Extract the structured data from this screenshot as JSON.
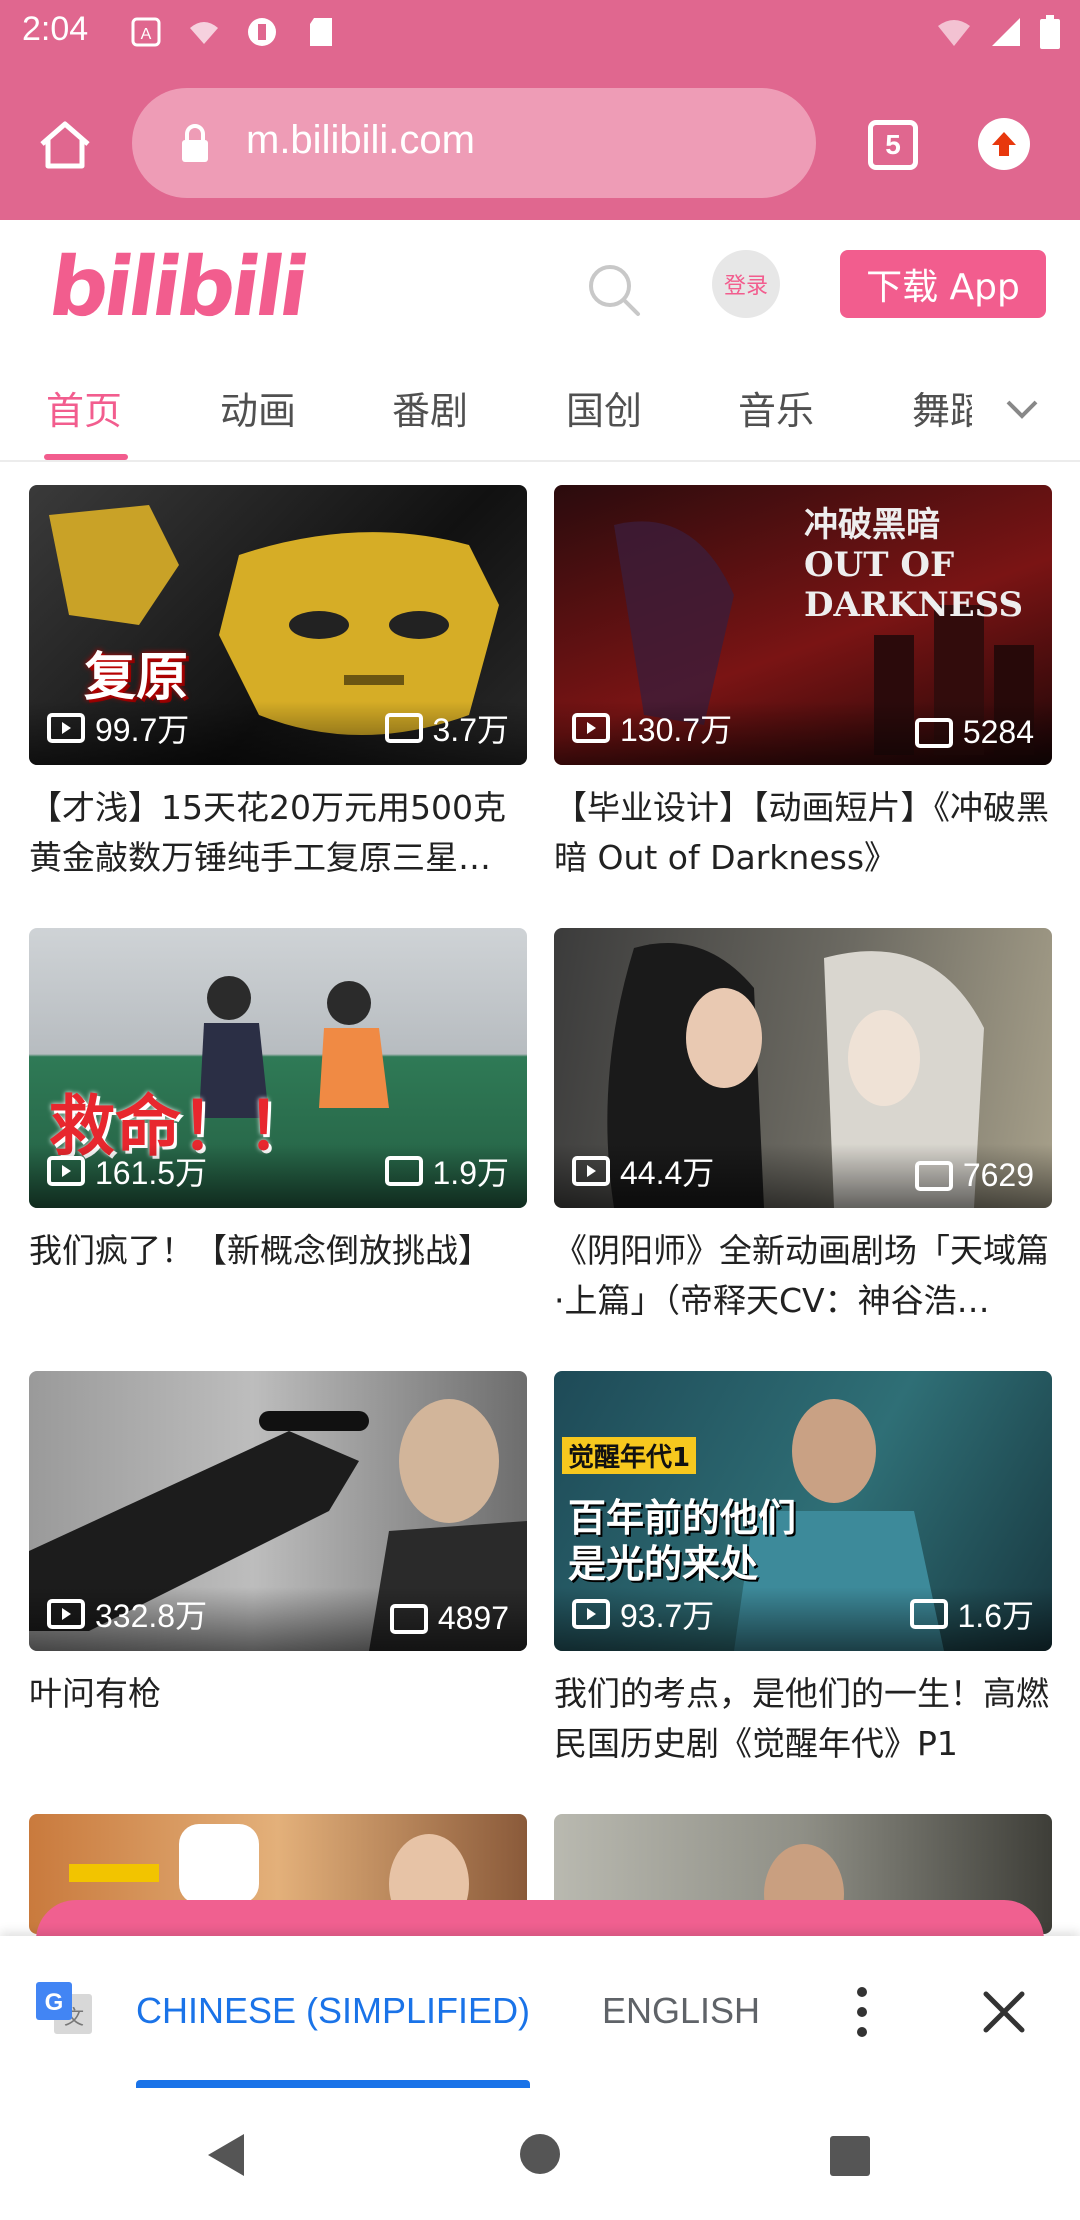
{
  "status_bar": {
    "time": "2:04"
  },
  "browser": {
    "url": "m.bilibili.com",
    "tab_count": "5"
  },
  "site": {
    "logo": "bilibili",
    "login": "登录",
    "download": "下载 App"
  },
  "nav": {
    "items": [
      "首页",
      "动画",
      "番剧",
      "国创",
      "音乐",
      "舞蹈"
    ],
    "active_index": 0
  },
  "videos": [
    {
      "views": "99.7万",
      "comments": "3.7万",
      "title": "【才浅】15天花20万元用500克黄金敲数万锤纯手工复原三星…",
      "overlay": "复原"
    },
    {
      "views": "130.7万",
      "comments": "5284",
      "title": "【毕业设计】【动画短片】《冲破黑暗 Out of Darkness》",
      "overlay": "冲破黑暗 OUT OF DARKNESS"
    },
    {
      "views": "161.5万",
      "comments": "1.9万",
      "title": "我们疯了！【新概念倒放挑战】",
      "overlay": "救命！！"
    },
    {
      "views": "44.4万",
      "comments": "7629",
      "title": "《阴阳师》全新动画剧场「天域篇·上篇」（帝释天CV：神谷浩…",
      "overlay": ""
    },
    {
      "views": "332.8万",
      "comments": "4897",
      "title": "叶问有枪",
      "overlay": ""
    },
    {
      "views": "93.7万",
      "comments": "1.6万",
      "title": "我们的考点，是他们的一生！高燃民国历史剧《觉醒年代》P1",
      "overlay_tag": "觉醒年代1",
      "overlay": "百年前的他们 是光的来处"
    }
  ],
  "translate": {
    "source_lang": "CHINESE (SIMPLIFIED)",
    "target_lang": "ENGLISH"
  },
  "colors": {
    "chrome": "#e0678f",
    "brand": "#f25d8e",
    "translate_blue": "#1a73e8"
  }
}
